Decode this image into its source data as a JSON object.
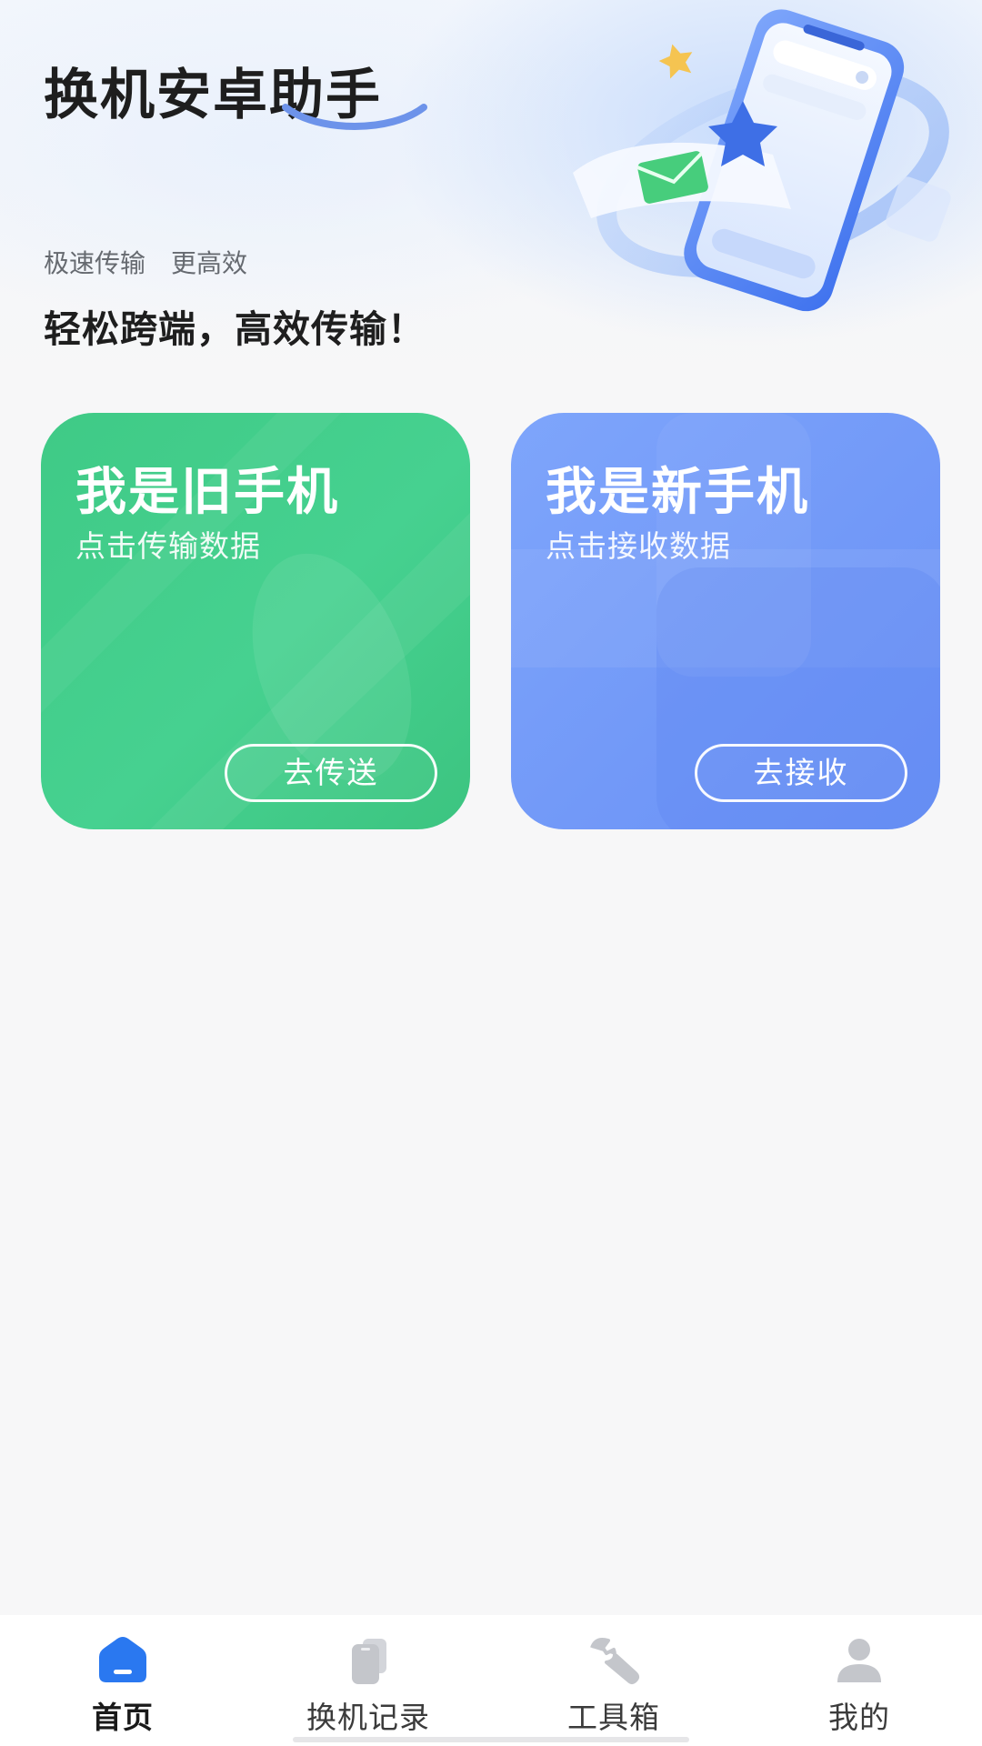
{
  "header": {
    "title": "换机安卓助手",
    "slogan_small": "极速传输　更高效",
    "slogan_big": "轻松跨端，高效传输！"
  },
  "cards": {
    "old_phone": {
      "title": "我是旧手机",
      "subtitle": "点击传输数据",
      "button": "去传送",
      "color": "#43cd8b"
    },
    "new_phone": {
      "title": "我是新手机",
      "subtitle": "点击接收数据",
      "button": "去接收",
      "color": "#7299f8"
    }
  },
  "tabbar": {
    "active_color": "#2a78f0",
    "inactive_color": "#c4c6cb",
    "tabs": [
      {
        "label": "首页",
        "icon": "home-icon",
        "active": true
      },
      {
        "label": "换机记录",
        "icon": "phone-records-icon",
        "active": false
      },
      {
        "label": "工具箱",
        "icon": "wrench-icon",
        "active": false
      },
      {
        "label": "我的",
        "icon": "user-icon",
        "active": false
      }
    ]
  }
}
